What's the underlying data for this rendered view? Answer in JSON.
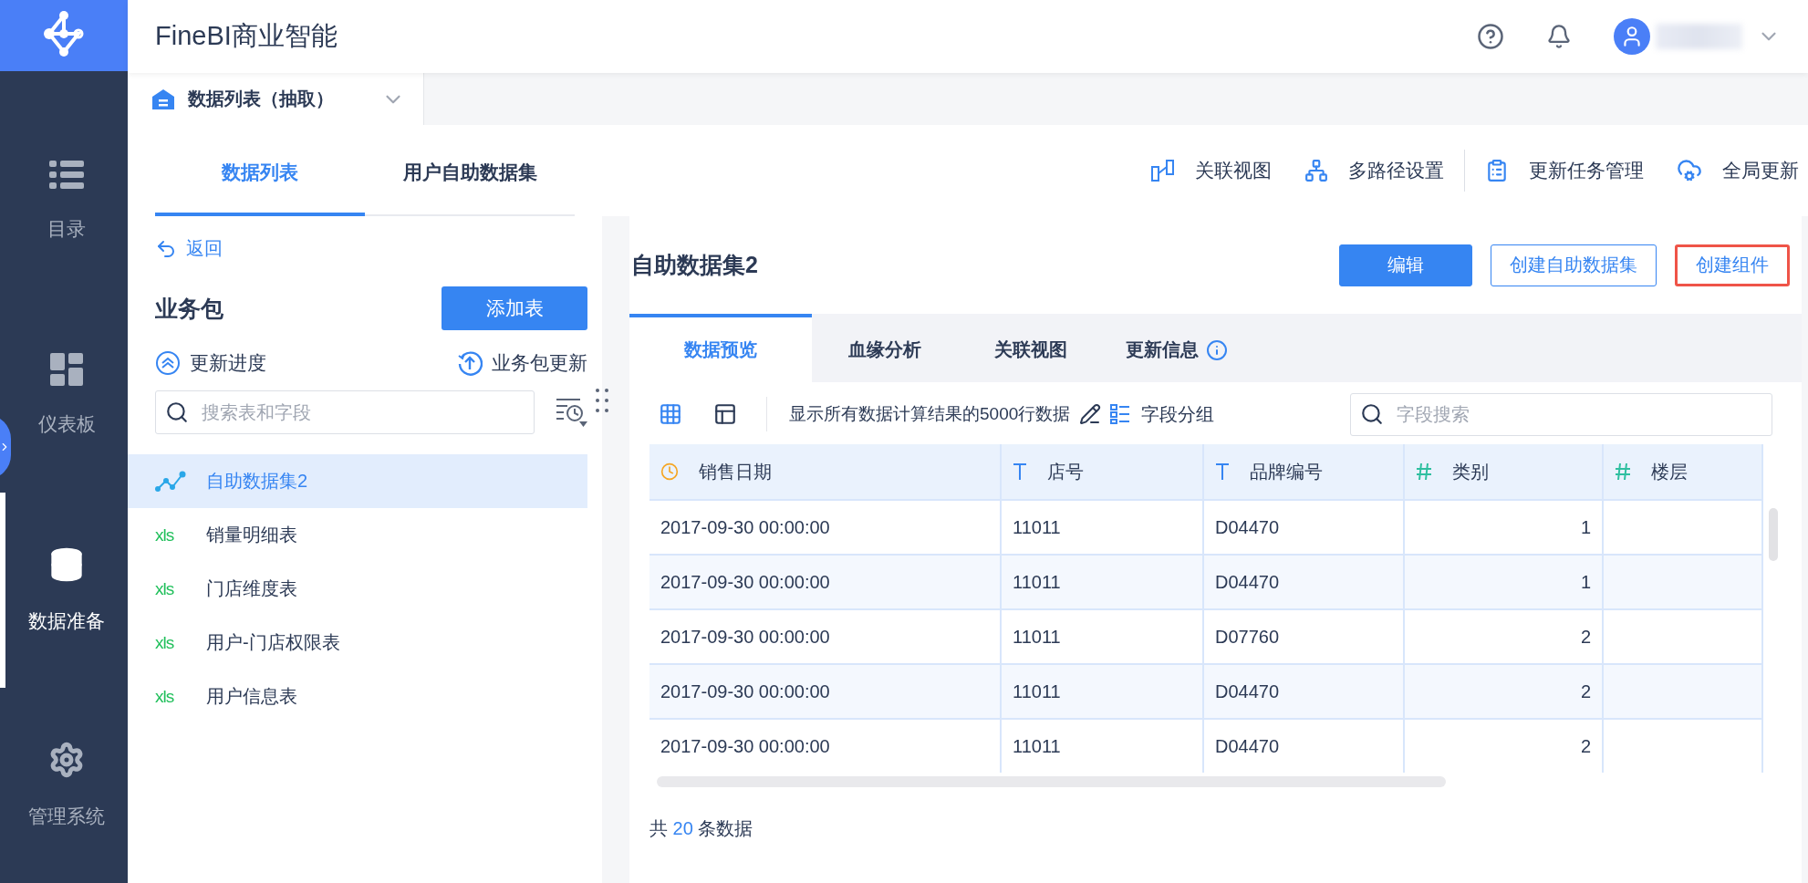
{
  "app": {
    "title": "FineBI商业智能"
  },
  "nav": [
    {
      "label": "目录",
      "selected": false
    },
    {
      "label": "仪表板",
      "selected": false
    },
    {
      "label": "数据准备",
      "selected": true
    },
    {
      "label": "管理系统",
      "selected": false
    }
  ],
  "header_tab": {
    "label": "数据列表（抽取）"
  },
  "left_tabs": [
    {
      "label": "数据列表",
      "selected": true
    },
    {
      "label": "用户自助数据集",
      "selected": false
    }
  ],
  "toolbar": [
    {
      "label": "关联视图"
    },
    {
      "label": "多路径设置"
    },
    {
      "label": "更新任务管理"
    },
    {
      "label": "全局更新"
    }
  ],
  "back": "返回",
  "package": {
    "title": "业务包",
    "add_button": "添加表",
    "progress": "更新进度",
    "update": "业务包更新",
    "search_placeholder": "搜索表和字段"
  },
  "tables": [
    {
      "name": "自助数据集2",
      "kind": "dataset",
      "selected": true
    },
    {
      "name": "销量明细表",
      "kind": "xls",
      "badge": "xls",
      "selected": false
    },
    {
      "name": "门店维度表",
      "kind": "xls",
      "badge": "xls",
      "selected": false
    },
    {
      "name": "用户-门店权限表",
      "kind": "xls",
      "badge": "xls",
      "selected": false
    },
    {
      "name": "用户信息表",
      "kind": "xls",
      "badge": "xls",
      "selected": false
    }
  ],
  "dataset": {
    "title": "自助数据集2",
    "buttons": [
      {
        "label": "编辑",
        "kind": "primary",
        "highlighted": false
      },
      {
        "label": "创建自助数据集",
        "kind": "outline",
        "highlighted": false
      },
      {
        "label": "创建组件",
        "kind": "outline",
        "highlighted": true
      }
    ],
    "tabs": [
      {
        "label": "数据预览",
        "selected": true,
        "info": false
      },
      {
        "label": "血缘分析",
        "selected": false,
        "info": false
      },
      {
        "label": "关联视图",
        "selected": false,
        "info": false
      },
      {
        "label": "更新信息",
        "selected": false,
        "info": true
      }
    ],
    "view_modes": [
      {
        "kind": "grid",
        "selected": true
      },
      {
        "kind": "layout",
        "selected": false
      }
    ],
    "row_notice": "显示所有数据计算结果的5000行数据",
    "group_label": "字段分组",
    "field_search_placeholder": "字段搜索",
    "table": {
      "columns": [
        {
          "label": "销售日期",
          "kind": "date"
        },
        {
          "label": "店号",
          "kind": "text"
        },
        {
          "label": "品牌编号",
          "kind": "text"
        },
        {
          "label": "类别",
          "kind": "number"
        },
        {
          "label": "楼层",
          "kind": "number"
        }
      ],
      "rows": [
        [
          "2017-09-30 00:00:00",
          "11011",
          "D04470",
          "1"
        ],
        [
          "2017-09-30 00:00:00",
          "11011",
          "D04470",
          "1"
        ],
        [
          "2017-09-30 00:00:00",
          "11011",
          "D07760",
          "2"
        ],
        [
          "2017-09-30 00:00:00",
          "11011",
          "D04470",
          "2"
        ],
        [
          "2017-09-30 00:00:00",
          "11011",
          "D04470",
          "2"
        ]
      ]
    },
    "footer": {
      "prefix": "共",
      "count": "20",
      "suffix": "条数据"
    }
  }
}
